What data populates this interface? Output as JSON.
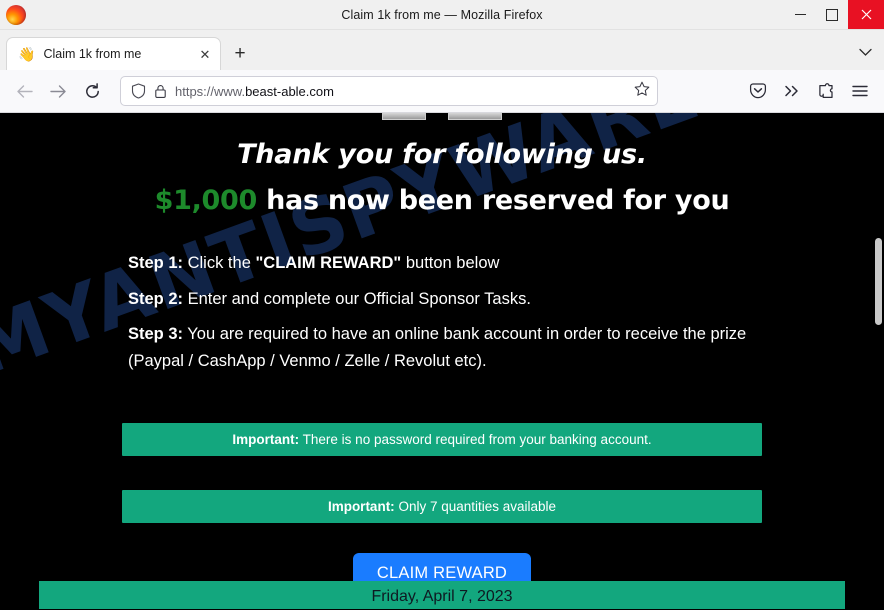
{
  "window": {
    "title": "Claim 1k from me — Mozilla Firefox",
    "logo_icon": "firefox-logo",
    "minimize_label": "",
    "maximize_label": "",
    "close_label": "✕"
  },
  "tabs": {
    "items": [
      {
        "favicon": "👋",
        "title": "Claim 1k from me",
        "close_label": "✕"
      }
    ],
    "new_tab_label": "+",
    "list_all_tabs_icon": "chevron-down-icon"
  },
  "navbar": {
    "back_label": "←",
    "forward_label": "→",
    "reload_label": "⟳",
    "shield_icon": "shield-icon",
    "lock_icon": "padlock-icon",
    "url_prefix": "https://www.",
    "url_domain": "beast-able.com",
    "bookmark_icon": "star-icon",
    "pocket_icon": "pocket-icon",
    "overflow_icon": "double-chevron-icon",
    "extensions_icon": "puzzle-piece-icon",
    "menu_icon": "hamburger-menu-icon"
  },
  "page": {
    "watermark": "MYANTISPYWARE.COM",
    "headline_1": "Thank you for following us.",
    "headline_2_amount": "$1,000",
    "headline_2_rest": " has now been reserved for you",
    "steps": [
      {
        "label": "Step 1:",
        "pre": " Click the ",
        "quoted": "\"CLAIM REWARD\"",
        "post": " button below"
      },
      {
        "label": "Step 2:",
        "pre": " Enter and complete our Official Sponsor Tasks.",
        "quoted": "",
        "post": ""
      },
      {
        "label": "Step 3:",
        "pre": " You are required to have an online bank account in order to receive the prize (Paypal / CashApp / Venmo / Zelle / Revolut etc).",
        "quoted": "",
        "post": ""
      }
    ],
    "banner_1_label": "Important:",
    "banner_1_text": " There is no password required from your banking account.",
    "banner_2_label": "Important:",
    "banner_2_text": " Only 7 quantities available",
    "claim_button": "CLAIM REWARD",
    "bottom_bar_text": "Friday, April 7, 2023"
  },
  "colors": {
    "banner_green": "#13a77e",
    "amount_green": "#1d8a2b",
    "claim_blue": "#1a7cff",
    "watermark_navy": "#12264d",
    "page_background": "#000000",
    "close_red": "#e81123"
  }
}
